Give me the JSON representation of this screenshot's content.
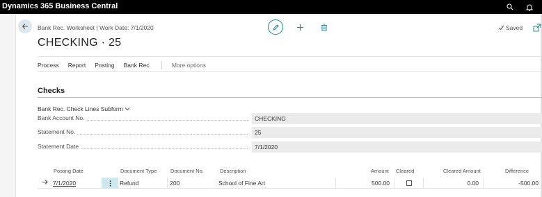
{
  "app": {
    "title": "Dynamics 365 Business Central",
    "icons": [
      "search-icon",
      "bell-icon"
    ]
  },
  "header": {
    "breadcrumb": "Bank Rec. Worksheet | Work Date: 7/1/2020",
    "title": "CHECKING · 25",
    "saved_label": "Saved",
    "icons": [
      "back-arrow-icon",
      "edit-pencil-icon",
      "plus-icon",
      "trash-icon",
      "checkmark-icon",
      "popout-icon"
    ],
    "accent_color": "#1f8a94"
  },
  "actions": {
    "items": [
      "Process",
      "Report",
      "Posting",
      "Bank Rec."
    ],
    "more": "More options"
  },
  "section": {
    "title": "Checks",
    "subform_title": "Bank Rec. Check Lines Subform"
  },
  "fields": [
    {
      "label": "Bank Account No.",
      "value": "CHECKING"
    },
    {
      "label": "Statement No.",
      "value": "25"
    },
    {
      "label": "Statement Date",
      "value": "7/1/2020"
    }
  ],
  "grid": {
    "columns": [
      "Posting Date",
      "Document Type",
      "Document No.",
      "Description",
      "Amount",
      "Cleared",
      "Cleared Amount",
      "Difference"
    ],
    "rows": [
      {
        "posting_date": "7/1/2020",
        "document_type": "Refund",
        "document_no": "200",
        "description": "School of Fine Art",
        "amount": "500.00",
        "cleared": false,
        "cleared_amount": "0.00",
        "difference": "-500.00"
      }
    ]
  }
}
